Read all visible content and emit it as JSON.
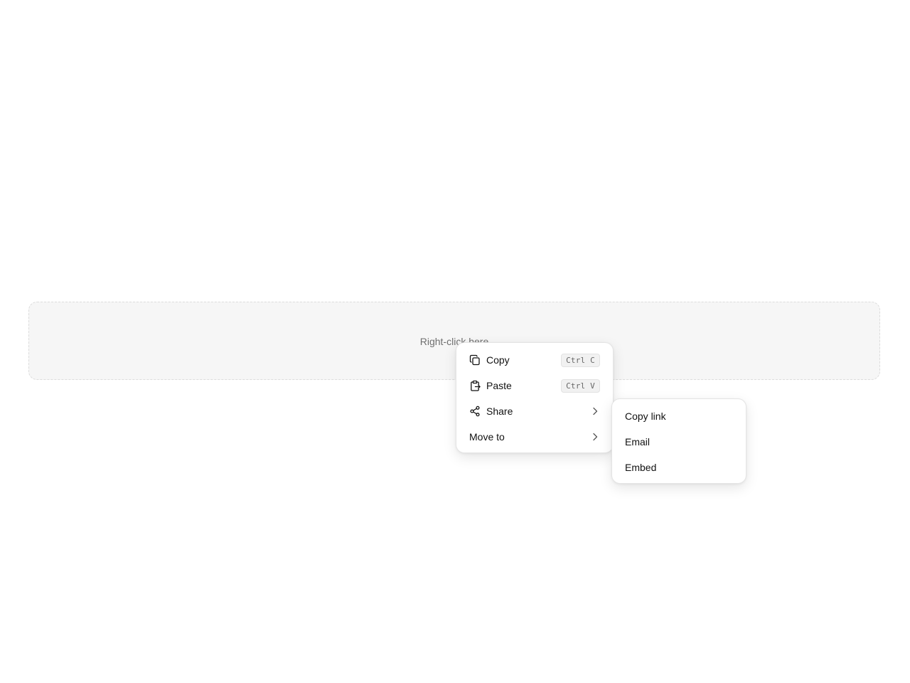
{
  "drop_zone": {
    "label": "Right-click here"
  },
  "context_menu": {
    "items": [
      {
        "label": "Copy",
        "icon": "copy-icon",
        "shortcut": "Ctrl C"
      },
      {
        "label": "Paste",
        "icon": "clipboard-paste-icon",
        "shortcut": "Ctrl V"
      },
      {
        "label": "Share",
        "icon": "share-icon",
        "submenu": true
      },
      {
        "label": "Move to",
        "submenu": true
      }
    ]
  },
  "submenu": {
    "parent": "Share",
    "items": [
      {
        "label": "Copy link"
      },
      {
        "label": "Email"
      },
      {
        "label": "Embed"
      }
    ]
  },
  "colors": {
    "drop_zone_background": "#f6f6f6",
    "menu_background": "#ffffff",
    "text": "#111111",
    "muted_text": "#6f6f6f"
  }
}
